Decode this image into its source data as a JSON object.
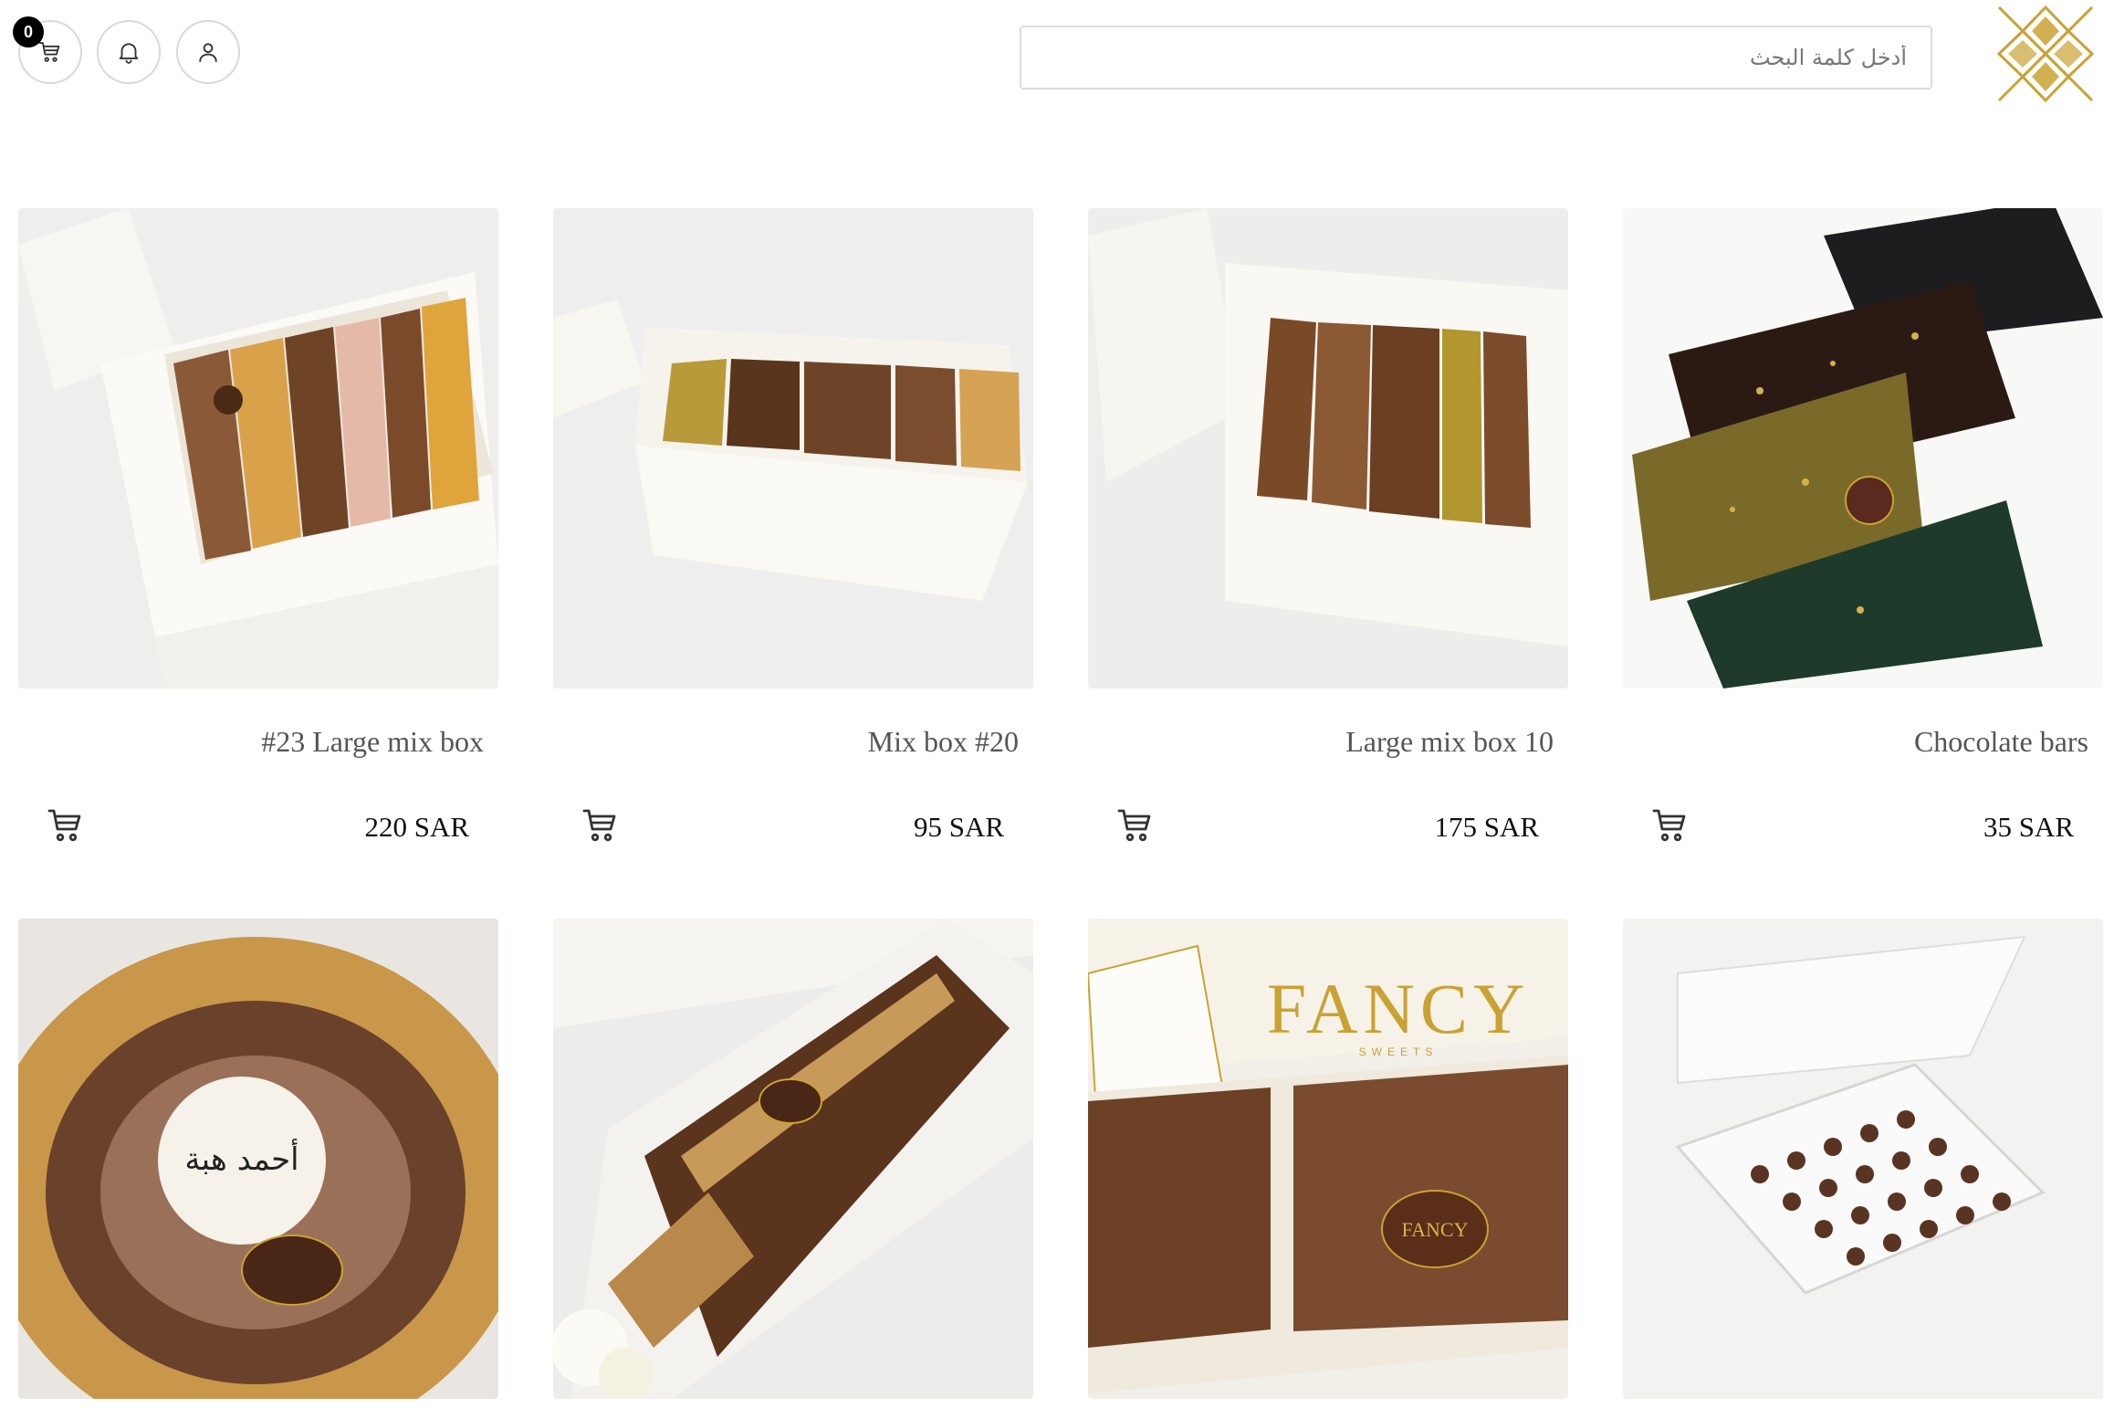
{
  "header": {
    "cart_count": "0",
    "search_placeholder": "أدخل كلمة البحث"
  },
  "icons": {
    "cart": "cart-icon",
    "bell": "bell-icon",
    "user": "user-icon",
    "logo": "logo-icon"
  },
  "colors": {
    "accent_gold": "#c9a233",
    "badge": "#000000",
    "border": "#d9d9d9"
  },
  "products": [
    {
      "name": "#23 Large mix box",
      "price": "220 SAR"
    },
    {
      "name": "Mix box #20",
      "price": "95 SAR"
    },
    {
      "name": "Large mix box 10",
      "price": "175 SAR"
    },
    {
      "name": "Chocolate bars",
      "price": "35 SAR"
    },
    {
      "name": "",
      "price": ""
    },
    {
      "name": "",
      "price": ""
    },
    {
      "name": "",
      "price": ""
    },
    {
      "name": "",
      "price": ""
    }
  ],
  "image_text": {
    "fancy_box_logo": "FANCY",
    "fancy_box_sub": "SWEETS",
    "plaque_text": "FANCY",
    "arabic_disc": "أحمد هبة"
  }
}
